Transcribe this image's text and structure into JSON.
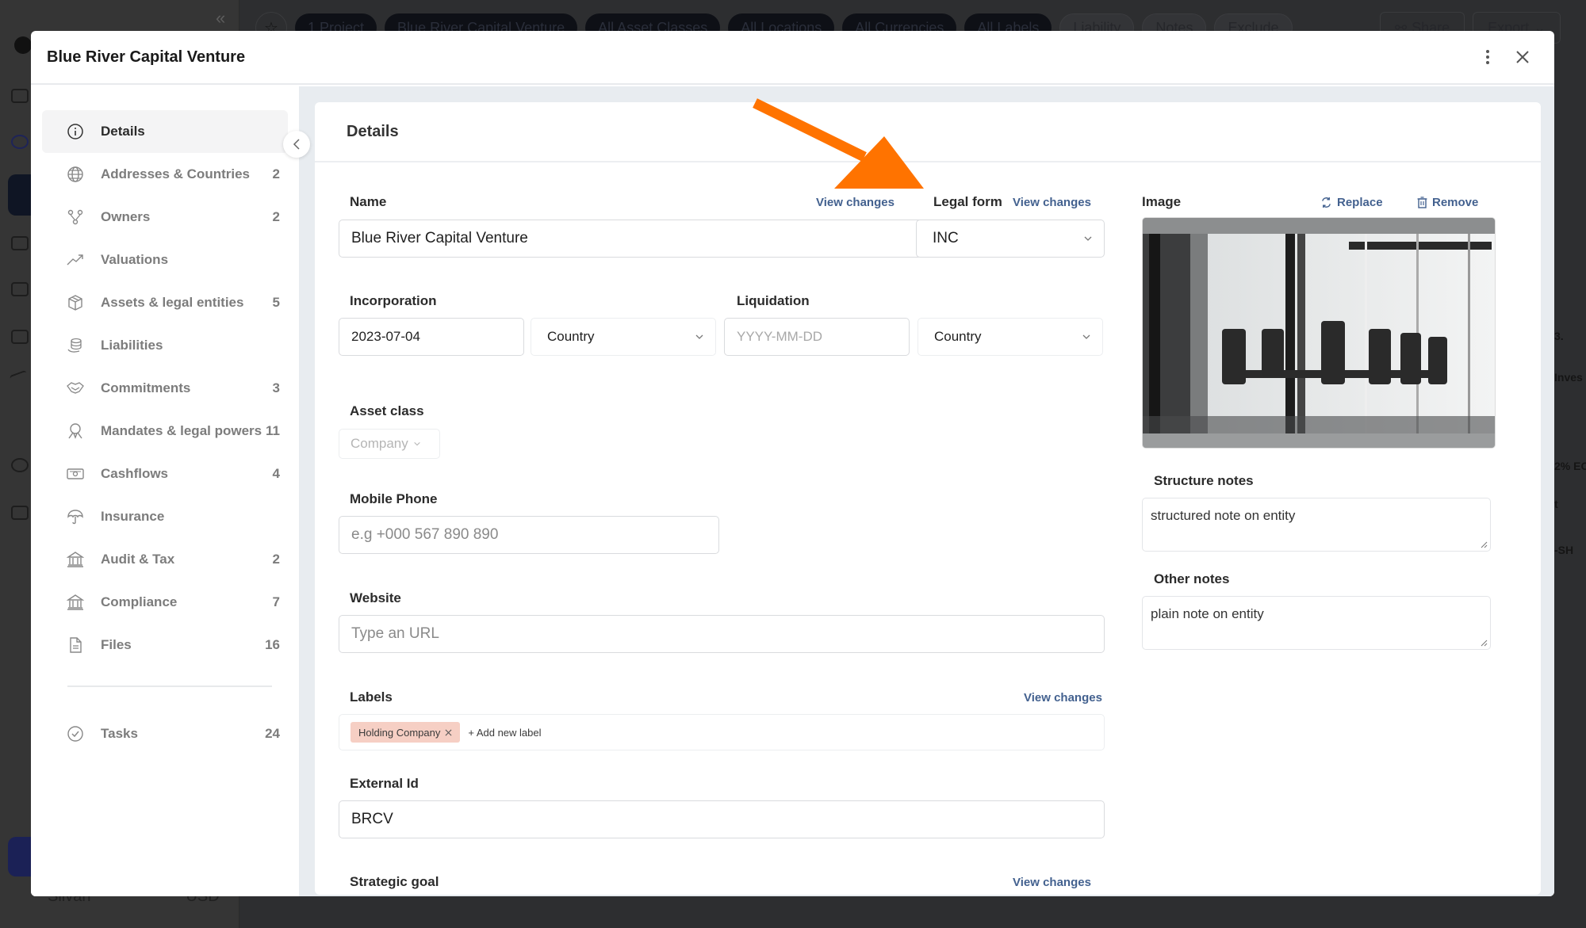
{
  "background_app": {
    "toolbar_chips": [
      "1 Project",
      "Blue River Capital Venture",
      "All Asset Classes",
      "All Locations",
      "All Currencies",
      "All Labels"
    ],
    "toolbar_toggles": [
      "Liability",
      "Notes",
      "Exclude"
    ],
    "share_label": "Share",
    "export_label": "Export",
    "user_name": "Silvan",
    "currency": "USD",
    "right_strip": [
      "3.",
      "Inves",
      "2% EC",
      "t",
      "-SH"
    ]
  },
  "modal": {
    "title": "Blue River Capital Venture",
    "more_icon": "more-vertical-icon",
    "close_icon": "close-icon"
  },
  "sidebar": {
    "items": [
      {
        "label": "Details",
        "count": "",
        "icon": "info-icon",
        "active": true
      },
      {
        "label": "Addresses & Countries",
        "count": "2",
        "icon": "globe-icon"
      },
      {
        "label": "Owners",
        "count": "2",
        "icon": "owners-icon"
      },
      {
        "label": "Valuations",
        "count": "",
        "icon": "trending-up-icon"
      },
      {
        "label": "Assets & legal entities",
        "count": "5",
        "icon": "package-icon"
      },
      {
        "label": "Liabilities",
        "count": "",
        "icon": "coins-hand-icon"
      },
      {
        "label": "Commitments",
        "count": "3",
        "icon": "handshake-icon"
      },
      {
        "label": "Mandates & legal powers",
        "count": "11",
        "icon": "award-icon"
      },
      {
        "label": "Cashflows",
        "count": "4",
        "icon": "banknote-icon"
      },
      {
        "label": "Insurance",
        "count": "",
        "icon": "umbrella-icon"
      },
      {
        "label": "Audit & Tax",
        "count": "2",
        "icon": "bank-icon"
      },
      {
        "label": "Compliance",
        "count": "7",
        "icon": "bank-icon"
      },
      {
        "label": "Files",
        "count": "16",
        "icon": "file-icon"
      }
    ],
    "tasks": {
      "label": "Tasks",
      "count": "24",
      "icon": "check-circle-icon"
    }
  },
  "details": {
    "title": "Details",
    "view_changes": "View changes",
    "name": {
      "label": "Name",
      "value": "Blue River Capital Venture"
    },
    "legal_form": {
      "label": "Legal form",
      "value": "INC"
    },
    "incorporation": {
      "label": "Incorporation",
      "date": "2023-07-04",
      "country_placeholder": "Country"
    },
    "liquidation": {
      "label": "Liquidation",
      "date_placeholder": "YYYY-MM-DD",
      "country_placeholder": "Country"
    },
    "asset_class": {
      "label": "Asset class",
      "value": "Company"
    },
    "mobile_phone": {
      "label": "Mobile Phone",
      "placeholder": "e.g +000 567 890 890"
    },
    "website": {
      "label": "Website",
      "placeholder": "Type an URL"
    },
    "labels": {
      "label": "Labels",
      "tags": [
        "Holding Company"
      ],
      "add_label": "+ Add new label"
    },
    "external_id": {
      "label": "External Id",
      "value": "BRCV"
    },
    "strategic_goal": {
      "label": "Strategic goal"
    },
    "image": {
      "label": "Image",
      "replace": "Replace",
      "remove": "Remove"
    },
    "structure_notes": {
      "label": "Structure notes",
      "value": "structured note on entity"
    },
    "other_notes": {
      "label": "Other notes",
      "value": "plain note on entity"
    }
  },
  "annotation": {
    "arrow_color": "#ff7300"
  },
  "colors": {
    "link": "#43618f",
    "tag_bg": "#f6cfc4",
    "accent_dark": "#1b2156"
  }
}
